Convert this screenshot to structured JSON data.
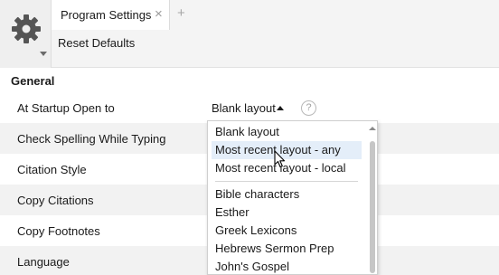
{
  "app": {
    "gear_icon": "gear-icon",
    "tab": {
      "label": "Program Settings",
      "close_glyph": "×"
    },
    "add_tab_glyph": "+",
    "reset_label": "Reset Defaults"
  },
  "settings": {
    "section": "General",
    "rows": [
      {
        "label": "At Startup Open to"
      },
      {
        "label": "Check Spelling While Typing"
      },
      {
        "label": "Citation Style"
      },
      {
        "label": "Copy Citations"
      },
      {
        "label": "Copy Footnotes"
      },
      {
        "label": "Language"
      }
    ],
    "startup_value": "Blank layout",
    "help_glyph": "?"
  },
  "dropdown": {
    "options_top": [
      "Blank layout",
      "Most recent layout - any",
      "Most recent layout - local"
    ],
    "options_layouts": [
      "Bible characters",
      "Esther",
      "Greek Lexicons",
      "Hebrews Sermon Prep",
      "John's Gospel"
    ],
    "hovered": "Most recent layout - any"
  },
  "colors": {
    "hover_bg": "#e4eef9",
    "alt_row_bg": "#f2f2f2",
    "gear": "#555555"
  }
}
